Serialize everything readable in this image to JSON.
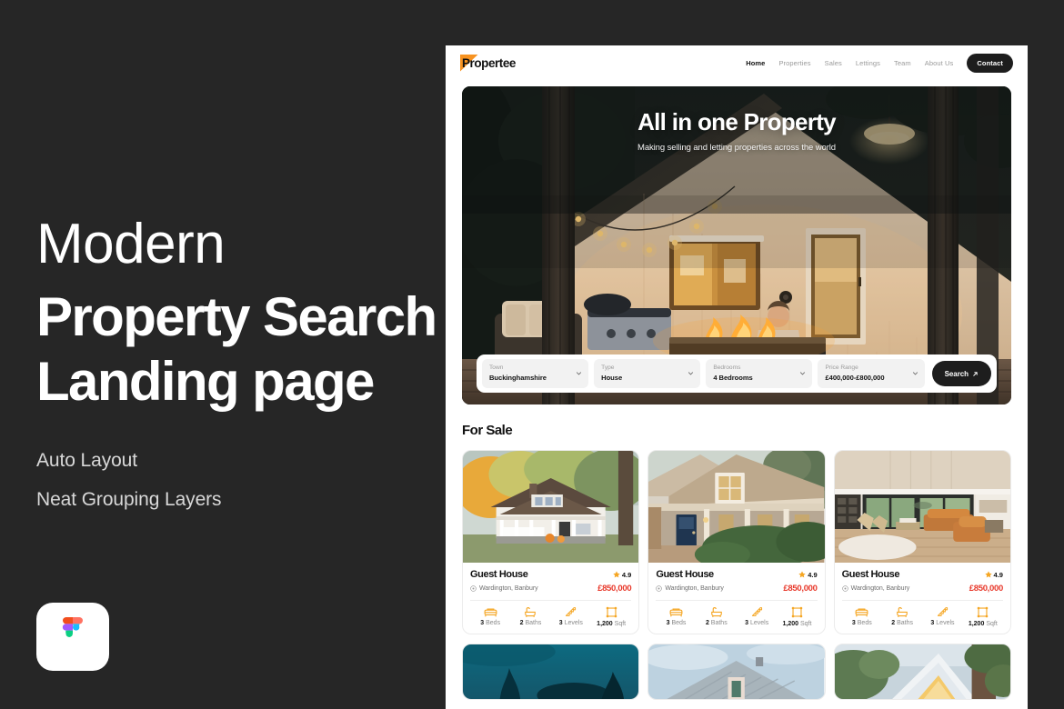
{
  "promo": {
    "line1": "Modern",
    "line2": "Property Search",
    "line3": "Landing page",
    "features": [
      "Auto Layout",
      "Neat Grouping Layers"
    ],
    "badge_icon": "figma-logo-icon",
    "background_color": "#262626"
  },
  "site": {
    "logo_text": "Propertee",
    "logo_accent_color": "#F79321",
    "nav_links": [
      {
        "label": "Home",
        "active": true
      },
      {
        "label": "Properties",
        "active": false
      },
      {
        "label": "Sales",
        "active": false
      },
      {
        "label": "Lettings",
        "active": false
      },
      {
        "label": "Team",
        "active": false
      },
      {
        "label": "About Us",
        "active": false
      }
    ],
    "cta_label": "Contact"
  },
  "hero": {
    "title": "All in one Property",
    "subtitle": "Making selling and letting properties across the world",
    "image_alt": "dusk-cabin-with-firepit-and-string-lights"
  },
  "search": {
    "fields": [
      {
        "label": "Town",
        "value": "Buckinghamshire"
      },
      {
        "label": "Type",
        "value": "House"
      },
      {
        "label": "Bedrooms",
        "value": "4 Bedrooms"
      },
      {
        "label": "Price Range",
        "value": "£400,000-£800,000"
      }
    ],
    "button_label": "Search",
    "button_icon": "arrow-up-right-icon"
  },
  "for_sale": {
    "title": "For Sale",
    "accent_price_color": "#E8392B",
    "icon_color": "#F5A623",
    "cards": [
      {
        "title": "Guest House",
        "rating": "4.9",
        "location": "Wardington, Banbury",
        "price": "£850,000",
        "image_alt": "white-bungalow-autumn-trees",
        "stats": [
          {
            "value": "3",
            "unit": "Beds",
            "icon": "bed-icon"
          },
          {
            "value": "2",
            "unit": "Baths",
            "icon": "bathtub-icon"
          },
          {
            "value": "3",
            "unit": "Levels",
            "icon": "stairs-icon"
          },
          {
            "value": "1,200",
            "unit": "Sqft",
            "icon": "area-icon"
          }
        ]
      },
      {
        "title": "Guest House",
        "rating": "4.9",
        "location": "Wardington, Banbury",
        "price": "£850,000",
        "image_alt": "beige-craftsman-house-navy-door",
        "stats": [
          {
            "value": "3",
            "unit": "Beds",
            "icon": "bed-icon"
          },
          {
            "value": "2",
            "unit": "Baths",
            "icon": "bathtub-icon"
          },
          {
            "value": "3",
            "unit": "Levels",
            "icon": "stairs-icon"
          },
          {
            "value": "1,200",
            "unit": "Sqft",
            "icon": "area-icon"
          }
        ]
      },
      {
        "title": "Guest House",
        "rating": "4.9",
        "location": "Wardington, Banbury",
        "price": "£850,000",
        "image_alt": "modern-living-room-tan-leather-sofas",
        "stats": [
          {
            "value": "3",
            "unit": "Beds",
            "icon": "bed-icon"
          },
          {
            "value": "2",
            "unit": "Baths",
            "icon": "bathtub-icon"
          },
          {
            "value": "3",
            "unit": "Levels",
            "icon": "stairs-icon"
          },
          {
            "value": "1,200",
            "unit": "Sqft",
            "icon": "area-icon"
          }
        ]
      }
    ],
    "cards_bottom": [
      {
        "image_alt": "teal-dusk-house-silhouette"
      },
      {
        "image_alt": "gray-shingle-roof-against-sky"
      },
      {
        "image_alt": "modern-white-house-with-tree"
      }
    ]
  }
}
